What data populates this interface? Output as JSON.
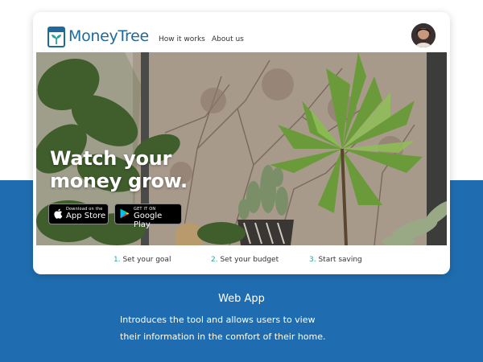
{
  "app": {
    "name": "MoneyTree"
  },
  "nav": {
    "links": [
      "How it works",
      "About us"
    ]
  },
  "hero": {
    "headline_line1": "Watch your",
    "headline_line2": "money grow."
  },
  "store_buttons": {
    "apple": {
      "small": "Download on the",
      "big": "App Store"
    },
    "google": {
      "small": "GET IT ON",
      "big": "Google Play"
    }
  },
  "steps": [
    {
      "num": "1.",
      "label": "Set your goal"
    },
    {
      "num": "2.",
      "label": "Set your budget"
    },
    {
      "num": "3.",
      "label": "Start saving"
    }
  ],
  "caption": {
    "title": "Web App",
    "line1": "Introduces the tool and allows users to view",
    "line2": "their information in the comfort of their home."
  },
  "colors": {
    "brand": "#1d6a9b",
    "accent_green": "#2aa59a",
    "band_blue": "#1f6db0"
  },
  "icons": {
    "logo": "sprout-jar-icon",
    "apple": "apple-logo-icon",
    "google": "google-play-icon"
  }
}
